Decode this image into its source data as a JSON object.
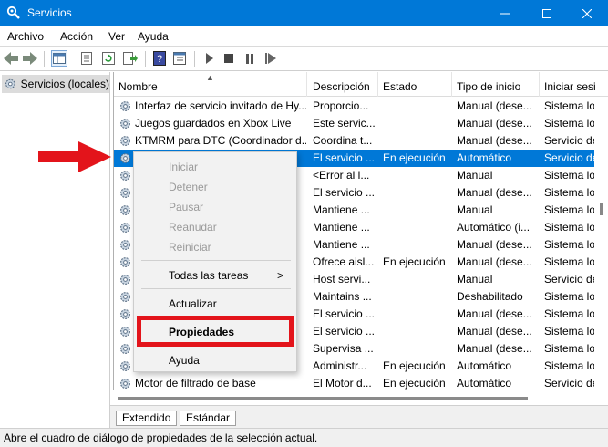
{
  "window": {
    "title": "Servicios"
  },
  "menubar": {
    "items": [
      "Archivo",
      "Acción",
      "Ver",
      "Ayuda"
    ]
  },
  "tree": {
    "root_label": "Servicios (locales)"
  },
  "columns": [
    "Nombre",
    "Descripción",
    "Estado",
    "Tipo de inicio",
    "Iniciar sesi"
  ],
  "rows": [
    {
      "name": "Interfaz de servicio invitado de Hy...",
      "desc": "Proporcio...",
      "state": "",
      "start": "Manual (dese...",
      "logon": "Sistema lo"
    },
    {
      "name": "Juegos guardados en Xbox Live",
      "desc": "Este servic...",
      "state": "",
      "start": "Manual (dese...",
      "logon": "Sistema lo"
    },
    {
      "name": "KTMRM para DTC (Coordinador d...",
      "desc": "Coordina t...",
      "state": "",
      "start": "Manual (dese...",
      "logon": "Servicio de"
    },
    {
      "name": "",
      "desc": "El servicio ...",
      "state": "En ejecución",
      "start": "Automático",
      "logon": "Servicio de",
      "selected": true
    },
    {
      "name": "",
      "desc": "<Error al l...",
      "state": "",
      "start": "Manual",
      "logon": "Sistema lo"
    },
    {
      "name": "",
      "desc": "El servicio ...",
      "state": "",
      "start": "Manual (dese...",
      "logon": "Sistema lo"
    },
    {
      "name": "",
      "desc": "Mantiene ...",
      "state": "",
      "start": "Manual",
      "logon": "Sistema lo"
    },
    {
      "name": "",
      "desc": "Mantiene ...",
      "state": "",
      "start": "Automático (i...",
      "logon": "Sistema lo"
    },
    {
      "name": "",
      "desc": "Mantiene ...",
      "state": "",
      "start": "Manual (dese...",
      "logon": "Sistema lo"
    },
    {
      "name": "",
      "desc": "Ofrece aisl...",
      "state": "En ejecución",
      "start": "Manual (dese...",
      "logon": "Sistema lo"
    },
    {
      "name": "",
      "desc": "Host servi...",
      "state": "",
      "start": "Manual",
      "logon": "Servicio de"
    },
    {
      "name": "",
      "desc": "Maintains ...",
      "state": "",
      "start": "Deshabilitado",
      "logon": "Sistema lo"
    },
    {
      "name": "",
      "desc": "El servicio ...",
      "state": "",
      "start": "Manual (dese...",
      "logon": "Sistema lo"
    },
    {
      "name": "",
      "desc": "El servicio ...",
      "state": "",
      "start": "Manual (dese...",
      "logon": "Sistema lo"
    },
    {
      "name": "",
      "desc": "Supervisa ...",
      "state": "",
      "start": "Manual (dese...",
      "logon": "Sistema lo"
    },
    {
      "name": "",
      "desc": "Administr...",
      "state": "En ejecución",
      "start": "Automático",
      "logon": "Sistema lo"
    },
    {
      "name": "Motor de filtrado de base",
      "desc": "El Motor d...",
      "state": "En ejecución",
      "start": "Automático",
      "logon": "Servicio de"
    }
  ],
  "context_menu": {
    "iniciar": "Iniciar",
    "detener": "Detener",
    "pausar": "Pausar",
    "reanudar": "Reanudar",
    "reiniciar": "Reiniciar",
    "todas_las_tareas": "Todas las tareas",
    "actualizar": "Actualizar",
    "propiedades": "Propiedades",
    "ayuda": "Ayuda",
    "submenu_arrow": ">"
  },
  "tabs": [
    "Extendido",
    "Estándar"
  ],
  "statusbar": {
    "text": "Abre el cuadro de diálogo de propiedades de la selección actual."
  },
  "colors": {
    "titlebar": "#0078d7",
    "selection": "#0078d7",
    "highlight_box": "#e3141b",
    "arrow": "#e3141b"
  },
  "icons": {
    "app": "gear-search-icon",
    "back": "back-arrow-icon",
    "forward": "forward-arrow-icon",
    "show-hide-tree": "console-tree-icon",
    "properties": "properties-sheet-icon",
    "refresh": "refresh-icon",
    "export": "export-list-icon",
    "help": "help-book-icon",
    "mmc": "mmc-view-icon",
    "play": "play-icon",
    "stop": "stop-icon",
    "pause": "pause-icon",
    "restart": "restart-icon",
    "service": "service-gear-icon"
  }
}
